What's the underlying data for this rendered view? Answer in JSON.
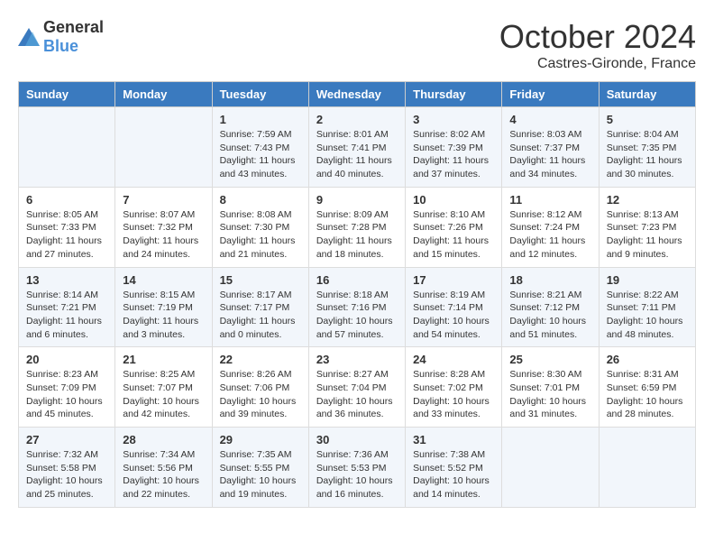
{
  "header": {
    "logo_general": "General",
    "logo_blue": "Blue",
    "month": "October 2024",
    "location": "Castres-Gironde, France"
  },
  "columns": [
    "Sunday",
    "Monday",
    "Tuesday",
    "Wednesday",
    "Thursday",
    "Friday",
    "Saturday"
  ],
  "weeks": [
    [
      {
        "day": "",
        "sunrise": "",
        "sunset": "",
        "daylight": ""
      },
      {
        "day": "",
        "sunrise": "",
        "sunset": "",
        "daylight": ""
      },
      {
        "day": "1",
        "sunrise": "Sunrise: 7:59 AM",
        "sunset": "Sunset: 7:43 PM",
        "daylight": "Daylight: 11 hours and 43 minutes."
      },
      {
        "day": "2",
        "sunrise": "Sunrise: 8:01 AM",
        "sunset": "Sunset: 7:41 PM",
        "daylight": "Daylight: 11 hours and 40 minutes."
      },
      {
        "day": "3",
        "sunrise": "Sunrise: 8:02 AM",
        "sunset": "Sunset: 7:39 PM",
        "daylight": "Daylight: 11 hours and 37 minutes."
      },
      {
        "day": "4",
        "sunrise": "Sunrise: 8:03 AM",
        "sunset": "Sunset: 7:37 PM",
        "daylight": "Daylight: 11 hours and 34 minutes."
      },
      {
        "day": "5",
        "sunrise": "Sunrise: 8:04 AM",
        "sunset": "Sunset: 7:35 PM",
        "daylight": "Daylight: 11 hours and 30 minutes."
      }
    ],
    [
      {
        "day": "6",
        "sunrise": "Sunrise: 8:05 AM",
        "sunset": "Sunset: 7:33 PM",
        "daylight": "Daylight: 11 hours and 27 minutes."
      },
      {
        "day": "7",
        "sunrise": "Sunrise: 8:07 AM",
        "sunset": "Sunset: 7:32 PM",
        "daylight": "Daylight: 11 hours and 24 minutes."
      },
      {
        "day": "8",
        "sunrise": "Sunrise: 8:08 AM",
        "sunset": "Sunset: 7:30 PM",
        "daylight": "Daylight: 11 hours and 21 minutes."
      },
      {
        "day": "9",
        "sunrise": "Sunrise: 8:09 AM",
        "sunset": "Sunset: 7:28 PM",
        "daylight": "Daylight: 11 hours and 18 minutes."
      },
      {
        "day": "10",
        "sunrise": "Sunrise: 8:10 AM",
        "sunset": "Sunset: 7:26 PM",
        "daylight": "Daylight: 11 hours and 15 minutes."
      },
      {
        "day": "11",
        "sunrise": "Sunrise: 8:12 AM",
        "sunset": "Sunset: 7:24 PM",
        "daylight": "Daylight: 11 hours and 12 minutes."
      },
      {
        "day": "12",
        "sunrise": "Sunrise: 8:13 AM",
        "sunset": "Sunset: 7:23 PM",
        "daylight": "Daylight: 11 hours and 9 minutes."
      }
    ],
    [
      {
        "day": "13",
        "sunrise": "Sunrise: 8:14 AM",
        "sunset": "Sunset: 7:21 PM",
        "daylight": "Daylight: 11 hours and 6 minutes."
      },
      {
        "day": "14",
        "sunrise": "Sunrise: 8:15 AM",
        "sunset": "Sunset: 7:19 PM",
        "daylight": "Daylight: 11 hours and 3 minutes."
      },
      {
        "day": "15",
        "sunrise": "Sunrise: 8:17 AM",
        "sunset": "Sunset: 7:17 PM",
        "daylight": "Daylight: 11 hours and 0 minutes."
      },
      {
        "day": "16",
        "sunrise": "Sunrise: 8:18 AM",
        "sunset": "Sunset: 7:16 PM",
        "daylight": "Daylight: 10 hours and 57 minutes."
      },
      {
        "day": "17",
        "sunrise": "Sunrise: 8:19 AM",
        "sunset": "Sunset: 7:14 PM",
        "daylight": "Daylight: 10 hours and 54 minutes."
      },
      {
        "day": "18",
        "sunrise": "Sunrise: 8:21 AM",
        "sunset": "Sunset: 7:12 PM",
        "daylight": "Daylight: 10 hours and 51 minutes."
      },
      {
        "day": "19",
        "sunrise": "Sunrise: 8:22 AM",
        "sunset": "Sunset: 7:11 PM",
        "daylight": "Daylight: 10 hours and 48 minutes."
      }
    ],
    [
      {
        "day": "20",
        "sunrise": "Sunrise: 8:23 AM",
        "sunset": "Sunset: 7:09 PM",
        "daylight": "Daylight: 10 hours and 45 minutes."
      },
      {
        "day": "21",
        "sunrise": "Sunrise: 8:25 AM",
        "sunset": "Sunset: 7:07 PM",
        "daylight": "Daylight: 10 hours and 42 minutes."
      },
      {
        "day": "22",
        "sunrise": "Sunrise: 8:26 AM",
        "sunset": "Sunset: 7:06 PM",
        "daylight": "Daylight: 10 hours and 39 minutes."
      },
      {
        "day": "23",
        "sunrise": "Sunrise: 8:27 AM",
        "sunset": "Sunset: 7:04 PM",
        "daylight": "Daylight: 10 hours and 36 minutes."
      },
      {
        "day": "24",
        "sunrise": "Sunrise: 8:28 AM",
        "sunset": "Sunset: 7:02 PM",
        "daylight": "Daylight: 10 hours and 33 minutes."
      },
      {
        "day": "25",
        "sunrise": "Sunrise: 8:30 AM",
        "sunset": "Sunset: 7:01 PM",
        "daylight": "Daylight: 10 hours and 31 minutes."
      },
      {
        "day": "26",
        "sunrise": "Sunrise: 8:31 AM",
        "sunset": "Sunset: 6:59 PM",
        "daylight": "Daylight: 10 hours and 28 minutes."
      }
    ],
    [
      {
        "day": "27",
        "sunrise": "Sunrise: 7:32 AM",
        "sunset": "Sunset: 5:58 PM",
        "daylight": "Daylight: 10 hours and 25 minutes."
      },
      {
        "day": "28",
        "sunrise": "Sunrise: 7:34 AM",
        "sunset": "Sunset: 5:56 PM",
        "daylight": "Daylight: 10 hours and 22 minutes."
      },
      {
        "day": "29",
        "sunrise": "Sunrise: 7:35 AM",
        "sunset": "Sunset: 5:55 PM",
        "daylight": "Daylight: 10 hours and 19 minutes."
      },
      {
        "day": "30",
        "sunrise": "Sunrise: 7:36 AM",
        "sunset": "Sunset: 5:53 PM",
        "daylight": "Daylight: 10 hours and 16 minutes."
      },
      {
        "day": "31",
        "sunrise": "Sunrise: 7:38 AM",
        "sunset": "Sunset: 5:52 PM",
        "daylight": "Daylight: 10 hours and 14 minutes."
      },
      {
        "day": "",
        "sunrise": "",
        "sunset": "",
        "daylight": ""
      },
      {
        "day": "",
        "sunrise": "",
        "sunset": "",
        "daylight": ""
      }
    ]
  ]
}
